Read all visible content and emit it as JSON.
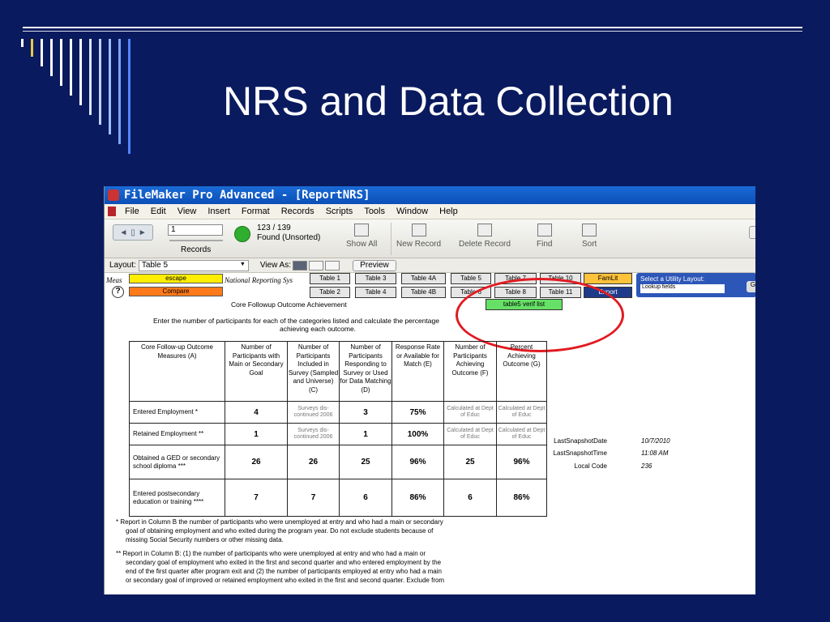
{
  "slide": {
    "title": "NRS and Data Collection",
    "deco_colors": [
      "#ffffff",
      "#e8c84a",
      "#ffffff",
      "#ffffff",
      "#ffffff",
      "#ffffff",
      "#ffffff",
      "#dbe6ff",
      "#bcd3ff",
      "#9cc0ff",
      "#7aa8ff",
      "#4f86ff"
    ]
  },
  "window": {
    "title": "FileMaker Pro Advanced - [ReportNRS]",
    "menu": [
      "File",
      "Edit",
      "View",
      "Insert",
      "Format",
      "Records",
      "Scripts",
      "Tools",
      "Window",
      "Help"
    ],
    "toolbar": {
      "record_number": "1",
      "records_label": "Records",
      "record_count": "123 / 139",
      "found_status": "Found (Unsorted)",
      "buttons": [
        "Show All",
        "New Record",
        "Delete Record",
        "Find",
        "Sort"
      ]
    },
    "layout_bar": {
      "layout_label": "Layout:",
      "layout_value": "Table 5",
      "view_as_label": "View As:",
      "preview_label": "Preview"
    }
  },
  "report": {
    "header_left": "Meas",
    "header_mid": "National Reporting Sys",
    "escape_label": "escape",
    "compare_label": "Compare",
    "help_icon_text": "?",
    "table_buttons_row1": [
      "Table 1",
      "Table 3",
      "Table 4A",
      "Table 5",
      "Table 7",
      "Table 10"
    ],
    "table_buttons_row2": [
      "Table 2",
      "Table 4",
      "Table 4B",
      "Table 6",
      "Table 8",
      "Table 11"
    ],
    "famlit_label": "FamLit",
    "export_label": "Export",
    "utility_label": "Select a Utility Layout:",
    "utility_value": "Lookup fields",
    "utility_go": "G",
    "verif_label": "table5 verif list",
    "subtitle": "Core Followup Outcome Achievement",
    "instruction_line1": "Enter the number of participants for each of the categories listed and calculate the percentage",
    "instruction_line2": "achieving each outcome.",
    "columns": [
      "Core Follow-up Outcome Measures (A)",
      "Number of Participants with Main or Secondary Goal",
      "Number of Participants Included in Survey (Sampled and Universe) (C)",
      "Number of Participants Responding to Survey or Used for Data Matching (D)",
      "Response Rate or Available for Match (E)",
      "Number of Participants Achieving Outcome (F)",
      "Percent Achieving Outcome (G)"
    ],
    "rows": [
      {
        "label": "Entered Employment *",
        "b": "4",
        "c": "Surveys dis-continued 2006",
        "d": "3",
        "e": "75%",
        "f": "Calculated at Dept of Educ",
        "g": "Calculated at Dept of Educ"
      },
      {
        "label": "Retained Employment **",
        "b": "1",
        "c": "Surveys dis-continued 2006",
        "d": "1",
        "e": "100%",
        "f": "Calculated at Dept of Educ",
        "g": "Calculated at Dept of Educ"
      },
      {
        "label": "Obtained a GED or secondary school diploma ***",
        "b": "26",
        "c": "26",
        "d": "25",
        "e": "96%",
        "f": "25",
        "g": "96%"
      },
      {
        "label": "Entered postsecondary education or training ****",
        "b": "7",
        "c": "7",
        "d": "6",
        "e": "86%",
        "f": "6",
        "g": "86%"
      }
    ],
    "snapshot": {
      "date_label": "LastSnapshotDate",
      "date_value": "10/7/2010",
      "time_label": "LastSnapshotTime",
      "time_value": "11:08 AM",
      "code_label": "Local Code",
      "code_value": "236"
    },
    "footnote1_line1": "* Report in Column B the number of participants who were unemployed at entry and who had a main or secondary",
    "footnote1_line2": "goal of obtaining employment and who exited during the program year. Do not exclude students because of",
    "footnote1_line3": "missing Social Security numbers or other missing data.",
    "footnote2_line1": "** Report in Column B: (1) the number of participants who were unemployed at entry and who had a main or",
    "footnote2_line2": "secondary goal of employment who exited in the first and second quarter and who entered employment by the",
    "footnote2_line3": "end of the first quarter after program exit and (2) the number of participants employed at entry who had a main",
    "footnote2_line4": "or secondary goal of improved or retained employment who exited in the first and second quarter. Exclude from"
  }
}
